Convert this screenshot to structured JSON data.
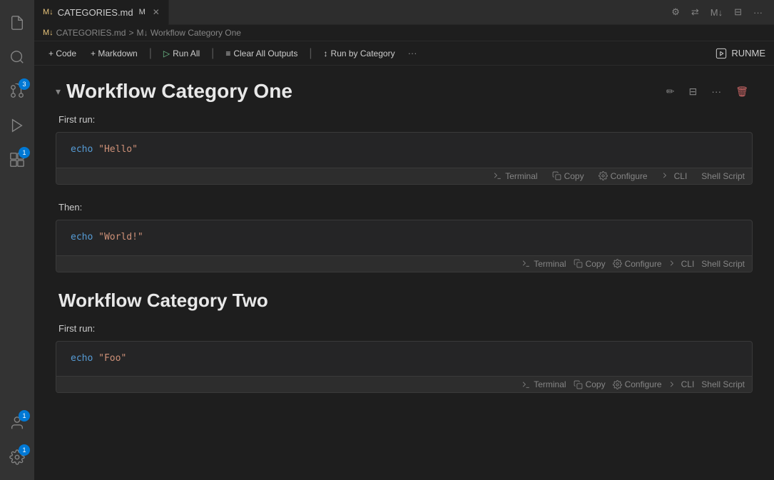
{
  "activityBar": {
    "icons": [
      {
        "name": "explorer-icon",
        "symbol": "⎘",
        "active": true,
        "badge": null
      },
      {
        "name": "search-icon",
        "symbol": "🔍",
        "active": false,
        "badge": null
      },
      {
        "name": "source-control-icon",
        "symbol": "⎇",
        "active": false,
        "badge": "3"
      },
      {
        "name": "run-icon",
        "symbol": "▷",
        "active": false,
        "badge": null
      },
      {
        "name": "extensions-icon",
        "symbol": "⊞",
        "active": false,
        "badge": "1"
      }
    ],
    "bottomIcons": [
      {
        "name": "account-icon",
        "symbol": "👤",
        "badge": "1"
      },
      {
        "name": "settings-icon",
        "symbol": "⚙",
        "badge": "1"
      }
    ]
  },
  "tabBar": {
    "tab": {
      "label": "CATEGORIES.md",
      "modified": true,
      "modifiedIndicator": "M"
    },
    "topRightIcons": [
      "⚙",
      "⇄",
      "M↓",
      "⊟",
      "···"
    ]
  },
  "breadcrumb": {
    "file": "CATEGORIES.md",
    "separator": ">",
    "section": "M↓ Workflow Category One"
  },
  "toolbar": {
    "buttons": [
      {
        "label": "+ Code",
        "name": "add-code-button"
      },
      {
        "label": "+ Markdown",
        "name": "add-markdown-button"
      },
      {
        "label": "▷ Run All",
        "name": "run-all-button"
      },
      {
        "label": "≡ Clear All Outputs",
        "name": "clear-all-outputs-button"
      },
      {
        "label": "↕ Run by Category",
        "name": "run-by-category-button"
      }
    ],
    "more": "···",
    "runme": "RUNME"
  },
  "sections": [
    {
      "id": "section-one",
      "title": "Workflow Category One",
      "cells": [
        {
          "label": "First run:",
          "code": "echo \"Hello\"",
          "codeFormatted": [
            {
              "text": "echo",
              "class": "code-keyword"
            },
            {
              "text": " "
            },
            {
              "text": "\"Hello\"",
              "class": "code-string"
            }
          ],
          "toolbar": [
            {
              "icon": "▶",
              "label": "Terminal",
              "name": "terminal-btn-1"
            },
            {
              "icon": "⎘",
              "label": "Copy",
              "name": "copy-btn-1"
            },
            {
              "icon": "⚙",
              "label": "Configure",
              "name": "configure-btn-1"
            },
            {
              "icon": "⌨",
              "label": "CLI",
              "name": "cli-btn-1"
            },
            {
              "label": "Shell Script",
              "name": "shell-script-label-1"
            }
          ]
        },
        {
          "label": "Then:",
          "code": "echo \"World!\"",
          "codeFormatted": [
            {
              "text": "echo",
              "class": "code-keyword"
            },
            {
              "text": " "
            },
            {
              "text": "\"World!\"",
              "class": "code-string"
            }
          ],
          "toolbar": [
            {
              "icon": "▶",
              "label": "Terminal",
              "name": "terminal-btn-2"
            },
            {
              "icon": "⎘",
              "label": "Copy",
              "name": "copy-btn-2"
            },
            {
              "icon": "⚙",
              "label": "Configure",
              "name": "configure-btn-2"
            },
            {
              "icon": "⌨",
              "label": "CLI",
              "name": "cli-btn-2"
            },
            {
              "label": "Shell Script",
              "name": "shell-script-label-2"
            }
          ]
        }
      ]
    },
    {
      "id": "section-two",
      "title": "Workflow Category Two",
      "cells": [
        {
          "label": "First run:",
          "code": "echo \"Foo\"",
          "codeFormatted": [
            {
              "text": "echo",
              "class": "code-keyword"
            },
            {
              "text": " "
            },
            {
              "text": "\"Foo\"",
              "class": "code-string"
            }
          ],
          "toolbar": [
            {
              "icon": "▶",
              "label": "Terminal",
              "name": "terminal-btn-3"
            },
            {
              "icon": "⎘",
              "label": "Copy",
              "name": "copy-btn-3"
            },
            {
              "icon": "⚙",
              "label": "Configure",
              "name": "configure-btn-3"
            },
            {
              "icon": "⌨",
              "label": "CLI",
              "name": "cli-btn-3"
            },
            {
              "label": "Shell Script",
              "name": "shell-script-label-3"
            }
          ]
        }
      ]
    }
  ],
  "cellActions": {
    "editIcon": "✏",
    "splitIcon": "⊟",
    "moreIcon": "···",
    "deleteIcon": "🗑"
  }
}
